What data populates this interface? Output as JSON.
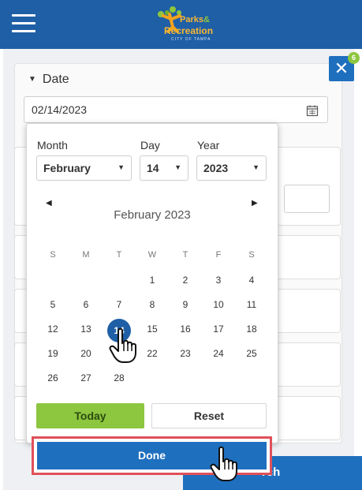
{
  "header": {
    "logo": {
      "line1": "Parks",
      "amp": "&",
      "line2": "Recreation",
      "line3": "CITY OF TAMPA"
    }
  },
  "date_section": {
    "title": "Date",
    "value": "02/14/2023"
  },
  "close_badge": "6",
  "search_button_label": "rch",
  "picker": {
    "month_label": "Month",
    "day_label": "Day",
    "year_label": "Year",
    "month_value": "February",
    "day_value": "14",
    "year_value": "2023",
    "calendar_title": "February 2023",
    "weekdays": [
      "S",
      "M",
      "T",
      "W",
      "T",
      "F",
      "S"
    ],
    "weeks": [
      [
        "",
        "",
        "",
        "1",
        "2",
        "3",
        "4"
      ],
      [
        "5",
        "6",
        "7",
        "8",
        "9",
        "10",
        "11"
      ],
      [
        "12",
        "13",
        "14",
        "15",
        "16",
        "17",
        "18"
      ],
      [
        "19",
        "20",
        "21",
        "22",
        "23",
        "24",
        "25"
      ],
      [
        "26",
        "27",
        "28",
        "",
        "",
        "",
        ""
      ]
    ],
    "selected_day": "14",
    "today_label": "Today",
    "reset_label": "Reset",
    "done_label": "Done"
  },
  "colors": {
    "header_blue": "#1f5fa6",
    "button_blue": "#1f6fbf",
    "today_green": "#8dc63f",
    "highlight_red": "#e0505a"
  }
}
